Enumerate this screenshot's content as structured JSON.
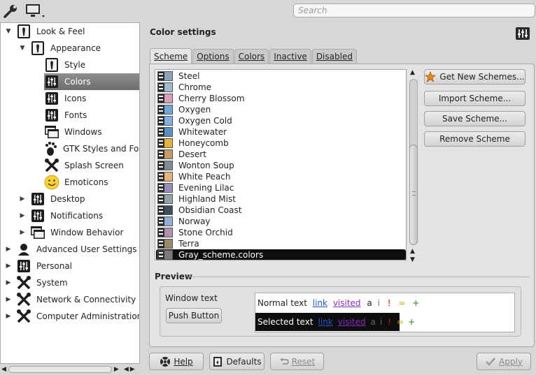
{
  "toolbar": {
    "icons": [
      "wrench-icon",
      "monitor-icon"
    ],
    "search_placeholder": "Search"
  },
  "sidebar": {
    "items": [
      {
        "label": "Look & Feel",
        "icon": "tie-icon",
        "level": 0,
        "expanded": true
      },
      {
        "label": "Appearance",
        "icon": "tie-icon",
        "level": 1,
        "expanded": true
      },
      {
        "label": "Style",
        "icon": "tie-icon",
        "level": 2
      },
      {
        "label": "Colors",
        "icon": "sliders-icon",
        "level": 2,
        "selected": true
      },
      {
        "label": "Icons",
        "icon": "sliders-icon",
        "level": 2
      },
      {
        "label": "Fonts",
        "icon": "sliders-icon",
        "level": 2
      },
      {
        "label": "Windows",
        "icon": "window-icon",
        "level": 2
      },
      {
        "label": "GTK Styles and Fon",
        "icon": "gnome-foot-icon",
        "level": 2
      },
      {
        "label": "Splash Screen",
        "icon": "tools-icon",
        "level": 2
      },
      {
        "label": "Emoticons",
        "icon": "smiley-icon",
        "level": 2
      },
      {
        "label": "Desktop",
        "icon": "sliders-icon",
        "level": 1
      },
      {
        "label": "Notifications",
        "icon": "sliders-icon",
        "level": 1
      },
      {
        "label": "Window Behavior",
        "icon": "window-icon",
        "level": 1
      },
      {
        "label": "Advanced User Settings",
        "icon": "user-icon",
        "level": 0
      },
      {
        "label": "Personal",
        "icon": "sliders-icon",
        "level": 0
      },
      {
        "label": "System",
        "icon": "tools-icon",
        "level": 0
      },
      {
        "label": "Network & Connectivity",
        "icon": "tools-icon",
        "level": 0
      },
      {
        "label": "Computer Administration",
        "icon": "tools-icon",
        "level": 0
      }
    ]
  },
  "main": {
    "title": "Color settings",
    "tabs": [
      "Scheme",
      "Options",
      "Colors",
      "Inactive",
      "Disabled"
    ],
    "schemes": [
      {
        "name": "Steel",
        "color": "#8aa3b8"
      },
      {
        "name": "Chrome",
        "color": "#9fb9d3"
      },
      {
        "name": "Cherry Blossom",
        "color": "#d99fb8"
      },
      {
        "name": "Oxygen",
        "color": "#6fa7d8"
      },
      {
        "name": "Oxygen Cold",
        "color": "#7fb0df"
      },
      {
        "name": "Whitewater",
        "color": "#5a8fc4"
      },
      {
        "name": "Honeycomb",
        "color": "#e5b23a"
      },
      {
        "name": "Desert",
        "color": "#c29a66"
      },
      {
        "name": "Wonton Soup",
        "color": "#7d8a97"
      },
      {
        "name": "White Peach",
        "color": "#e7b27a"
      },
      {
        "name": "Evening Lilac",
        "color": "#9a8bb9"
      },
      {
        "name": "Highland Mist",
        "color": "#8fa4a7"
      },
      {
        "name": "Obsidian Coast",
        "color": "#3b4d5e"
      },
      {
        "name": "Norway",
        "color": "#8fb0d0"
      },
      {
        "name": "Stone Orchid",
        "color": "#b18fb0"
      },
      {
        "name": "Terra",
        "color": "#9b8a6a"
      },
      {
        "name": "Gray_scheme.colors",
        "color": "#7a7a7a",
        "selected": true
      }
    ],
    "buttons": {
      "get_new": "Get New Schemes...",
      "import": "Import Scheme...",
      "save": "Save Scheme...",
      "remove": "Remove Scheme"
    },
    "preview": {
      "label": "Preview",
      "window_text": "Window text",
      "push_button": "Push Button",
      "normal_text": "Normal text",
      "selected_text": "Selected text",
      "link": "link",
      "visited": "visited",
      "a": "a",
      "i": "i",
      "excl": "!",
      "eq": "=",
      "plus": "+"
    }
  },
  "footer": {
    "help": "Help",
    "defaults": "Defaults",
    "reset": "Reset",
    "apply": "Apply"
  }
}
